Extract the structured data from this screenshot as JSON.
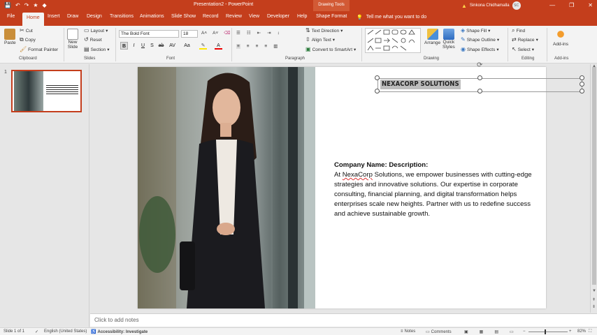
{
  "window": {
    "title": "Presentation2 - PowerPoint",
    "context_tab_group": "Drawing Tools",
    "user_name": "Sinkona Chidhamalla",
    "user_initials": "SC",
    "controls": [
      "—",
      "❐",
      "✕"
    ],
    "accent_color": "#c43e1c"
  },
  "qat": [
    "💾",
    "↶",
    "↷",
    "★",
    "◆"
  ],
  "tabs": [
    "File",
    "Home",
    "Insert",
    "Draw",
    "Design",
    "Transitions",
    "Animations",
    "Slide Show",
    "Record",
    "Review",
    "View",
    "Developer",
    "Help",
    "Shape Format"
  ],
  "tell_me": "Tell me what you want to do",
  "ribbon": {
    "clipboard": {
      "label": "Clipboard",
      "paste": "Paste",
      "cut": "Cut",
      "copy": "Copy",
      "format_painter": "Format Painter"
    },
    "slides": {
      "label": "Slides",
      "new_slide": "New",
      "new_slide2": "Slide",
      "layout": "Layout",
      "reset": "Reset",
      "section": "Section"
    },
    "font": {
      "label": "Font",
      "name": "The Bold Font",
      "size": "18"
    },
    "paragraph": {
      "label": "Paragraph",
      "text_direction": "Text Direction",
      "align_text": "Align Text",
      "smartart": "Convert to SmartArt"
    },
    "drawing": {
      "label": "Drawing",
      "arrange": "Arrange",
      "quick_styles": "Quick",
      "quick_styles2": "Styles",
      "shape_fill": "Shape Fill",
      "shape_outline": "Shape Outline",
      "shape_effects": "Shape Effects"
    },
    "editing": {
      "label": "Editing",
      "find": "Find",
      "replace": "Replace",
      "select": "Select"
    },
    "addins": {
      "label": "Add-ins",
      "addins": "Add-ins"
    }
  },
  "thumbnails": [
    {
      "number": "1"
    }
  ],
  "slide": {
    "title": "NEXACORP SOLUTIONS",
    "heading": "Company Name: Description:",
    "body_prefix": "At ",
    "body_misspelled": "NexaCorp",
    "body_rest": " Solutions, we empower businesses with cutting-edge strategies and innovative solutions. Our expertise in corporate consulting, financial planning, and digital transformation helps enterprises scale new heights. Partner with us to redefine success and achieve sustainable growth."
  },
  "notes_placeholder": "Click to add notes",
  "status": {
    "slide_of": "Slide 1 of 1",
    "language": "English (United States)",
    "accessibility": "Accessibility: Investigate",
    "notes": "Notes",
    "comments": "Comments",
    "zoom": "82%"
  }
}
